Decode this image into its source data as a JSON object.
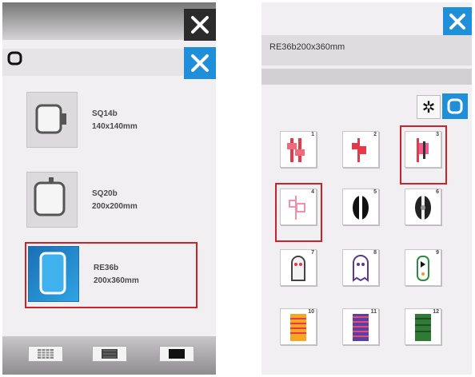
{
  "left_panel": {
    "hoops": [
      {
        "name": "SQ14b",
        "size": "140x140mm"
      },
      {
        "name": "SQ20b",
        "size": "200x200mm"
      },
      {
        "name": "RE36b",
        "size": "200x360mm"
      }
    ],
    "selected_hoop": "RE36b"
  },
  "right_panel": {
    "title": "RE36b200x360mm",
    "designs": [
      {
        "number": "1",
        "selected": false
      },
      {
        "number": "2",
        "selected": false
      },
      {
        "number": "3",
        "selected": true
      },
      {
        "number": "4",
        "selected": true
      },
      {
        "number": "5",
        "selected": false
      },
      {
        "number": "6",
        "selected": false
      },
      {
        "number": "7",
        "selected": false
      },
      {
        "number": "8",
        "selected": false
      },
      {
        "number": "9",
        "selected": false
      },
      {
        "number": "10",
        "selected": false
      },
      {
        "number": "11",
        "selected": false
      },
      {
        "number": "12",
        "selected": false
      }
    ]
  },
  "colors": {
    "accent_blue": "#1e8fd8",
    "selection_red": "#cc2229",
    "dark_button": "#2b2b2b",
    "panel_bg": "#f1eff1"
  },
  "icons": [
    "close-icon",
    "hoop-frame-icon",
    "settings-gear-icon",
    "stitch-pattern-icon"
  ]
}
